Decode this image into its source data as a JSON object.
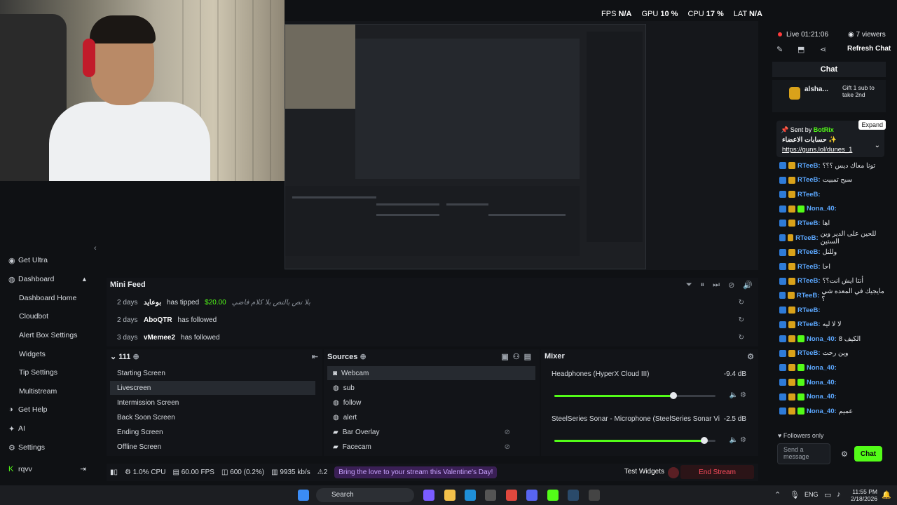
{
  "top_stats": {
    "fps_label": "FPS",
    "fps_value": "N/A",
    "gpu_label": "GPU",
    "gpu_value": "10 %",
    "cpu_label": "CPU",
    "cpu_value": "17 %",
    "lat_label": "LAT",
    "lat_value": "N/A"
  },
  "nav": {
    "get_ultra": "Get Ultra",
    "dashboard": "Dashboard",
    "dashboard_home": "Dashboard Home",
    "cloudbot": "Cloudbot",
    "alert_box_settings": "Alert Box Settings",
    "widgets": "Widgets",
    "tip_settings": "Tip Settings",
    "multistream": "Multistream",
    "get_help": "Get Help",
    "ai": "AI",
    "settings": "Settings",
    "user": "rqvv"
  },
  "mini_feed": {
    "title": "Mini Feed",
    "rows": [
      {
        "age": "2 days",
        "user": "بوعايد",
        "action": "has tipped",
        "amount": "$20.00",
        "message": "بلا نص بالنص بلا كلام فاضي"
      },
      {
        "age": "2 days",
        "user": "AboQTR",
        "action": "has followed"
      },
      {
        "age": "3 days",
        "user": "vMemee2",
        "action": "has followed"
      }
    ]
  },
  "scenes": {
    "collection": "111",
    "items": [
      "Starting Screen",
      "Livescreen",
      "Intermission Screen",
      "Back Soon Screen",
      "Ending Screen",
      "Offline Screen"
    ],
    "active_index": 1
  },
  "sources": {
    "title": "Sources",
    "items": [
      "Webcam",
      "sub",
      "follow",
      "alert",
      "Bar Overlay",
      "Facecam"
    ]
  },
  "mixer": {
    "title": "Mixer",
    "channels": [
      {
        "name": "Headphones (HyperX Cloud III)",
        "db": "-9.4 dB",
        "level": 0.74
      },
      {
        "name": "SteelSeries Sonar - Microphone (SteelSeries Sonar Virtu...",
        "db": "-2.5 dB",
        "level": 0.93
      }
    ]
  },
  "status_bar": {
    "cpu": "1.0% CPU",
    "fps": "60.00 FPS",
    "dropped": "600 (0.2%)",
    "bitrate": "9935 kb/s",
    "alerts": "2",
    "promo": "Bring the love to your stream this Valentine's Day!",
    "test_widgets": "Test Widgets",
    "end_stream": "End Stream"
  },
  "chat": {
    "live": "Live 01:21:06",
    "viewers": "7 viewers",
    "refresh": "Refresh Chat",
    "title": "Chat",
    "gift_user": "alsha...",
    "gift_text": "Gift 1 sub to take 2nd",
    "pinned_by": "Sent by",
    "pinned_bot": "BotRix",
    "pinned_text": "حسابات الاعضاء ✨",
    "pinned_link": "https://guns.lol/dunes_1",
    "expand": "Expand",
    "messages": [
      {
        "user": "RTeeB:",
        "msg": "تونا معاك ديس ؟؟؟"
      },
      {
        "user": "RTeeB:",
        "msg": "سبح تمبيت"
      },
      {
        "user": "RTeeB:",
        "msg": ""
      },
      {
        "user": "Nona_40:",
        "msg": ""
      },
      {
        "user": "RTeeB:",
        "msg": "اها"
      },
      {
        "user": "RTeeB:",
        "msg": "للحين على الدير وين الستين"
      },
      {
        "user": "RTeeB:",
        "msg": "وللنل"
      },
      {
        "user": "RTeeB:",
        "msg": "احا"
      },
      {
        "user": "RTeeB:",
        "msg": "أنتا ايش انت؟؟"
      },
      {
        "user": "RTeeB:",
        "msg": "مايجيك في المعده شي ؟"
      },
      {
        "user": "RTeeB:",
        "msg": ""
      },
      {
        "user": "RTeeB:",
        "msg": "لا لا ليه"
      },
      {
        "user": "Nona_40:",
        "msg": "الكيف 8"
      },
      {
        "user": "RTeeB:",
        "msg": "وين رحت"
      },
      {
        "user": "Nona_40:",
        "msg": ""
      },
      {
        "user": "Nona_40:",
        "msg": ""
      },
      {
        "user": "Nona_40:",
        "msg": ""
      },
      {
        "user": "Nona_40:",
        "msg": "عميم"
      }
    ],
    "followers_only": "Followers only",
    "input_placeholder": "Send a message",
    "send": "Chat"
  },
  "taskbar": {
    "search": "Search",
    "lang": "ENG",
    "time": "11:55 PM",
    "date": "2/18/2026"
  }
}
